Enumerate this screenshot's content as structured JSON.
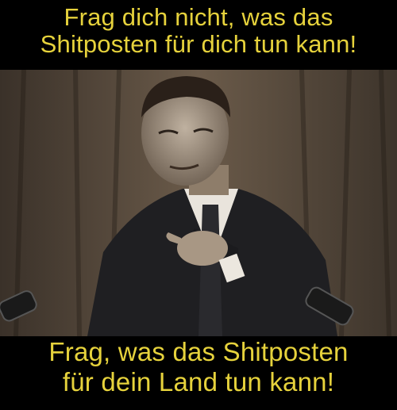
{
  "meme": {
    "top_line_1": "Frag dich nicht, was das",
    "top_line_2": "Shitposten für dich tun kann!",
    "bottom_line_1": "Frag, was das Shitposten",
    "bottom_line_2": "für dein Land tun kann!",
    "caption_color": "#e6d23c",
    "background_color": "#000000"
  },
  "photo": {
    "subject": "man-in-suit-pointing-at-viewer-icon"
  }
}
